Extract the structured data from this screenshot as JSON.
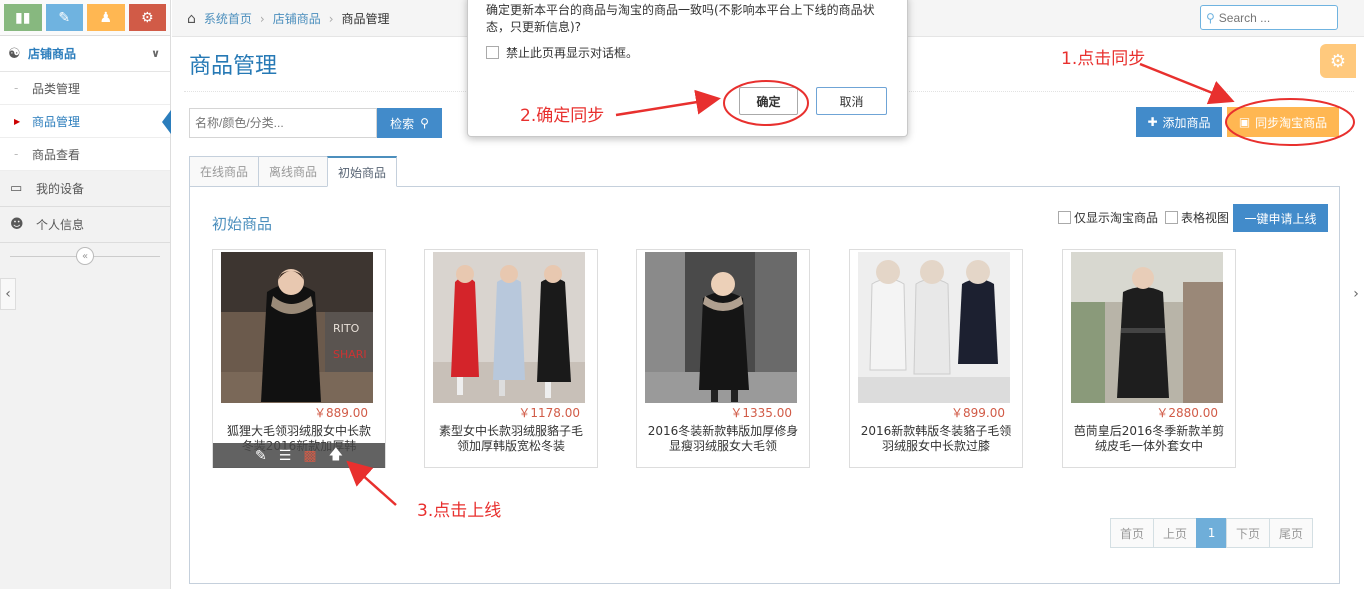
{
  "sidebar": {
    "shortcut_icons": [
      "bar-chart-icon",
      "pencil-icon",
      "group-icon",
      "cogs-icon"
    ],
    "group": {
      "label": "店铺商品"
    },
    "sub_items": [
      {
        "label": "品类管理"
      },
      {
        "label": "商品管理"
      },
      {
        "label": "商品查看"
      }
    ],
    "items": [
      {
        "label": "我的设备"
      },
      {
        "label": "个人信息"
      }
    ]
  },
  "breadcrumb": {
    "home": "系统首页",
    "section": "店铺商品",
    "current": "商品管理"
  },
  "search": {
    "placeholder": "Search ..."
  },
  "page": {
    "title": "商品管理"
  },
  "filter": {
    "placeholder": "名称/颜色/分类...",
    "button": "检索"
  },
  "actions": {
    "add": "添加商品",
    "sync": "同步淘宝商品"
  },
  "tabs": [
    {
      "label": "在线商品"
    },
    {
      "label": "离线商品"
    },
    {
      "label": "初始商品"
    }
  ],
  "panel": {
    "title": "初始商品",
    "opt_taobao": "仅显示淘宝商品",
    "opt_table": "表格视图",
    "apply_button": "一键申请上线"
  },
  "products": [
    {
      "price": "￥889.00",
      "name": "狐狸大毛领羽绒服女中长款冬装2016新款加厚韩"
    },
    {
      "price": "￥1178.00",
      "name": "素型女中长款羽绒服貉子毛领加厚韩版宽松冬装"
    },
    {
      "price": "￥1335.00",
      "name": "2016冬装新款韩版加厚修身显瘦羽绒服女大毛领"
    },
    {
      "price": "￥899.00",
      "name": "2016新款韩版冬装貉子毛领羽绒服女中长款过膝"
    },
    {
      "price": "￥2880.00",
      "name": "芭茼皇后2016冬季新款羊剪绒皮毛一体外套女中"
    }
  ],
  "pager": {
    "first": "首页",
    "prev": "上页",
    "current": "1",
    "next": "下页",
    "last": "尾页"
  },
  "dialog": {
    "message": "确定更新本平台的商品与淘宝的商品一致吗(不影响本平台上下线的商品状态，只更新信息)?",
    "checkbox": "禁止此页再显示对话框。",
    "ok": "确定",
    "cancel": "取消"
  },
  "annotations": {
    "step1": "1.点击同步",
    "step2": "2.确定同步",
    "step3": "3.点击上线"
  },
  "colors": {
    "accent": "#428bca",
    "warning": "#ffb752",
    "annotation": "#e8302e",
    "price": "#d15b47"
  }
}
